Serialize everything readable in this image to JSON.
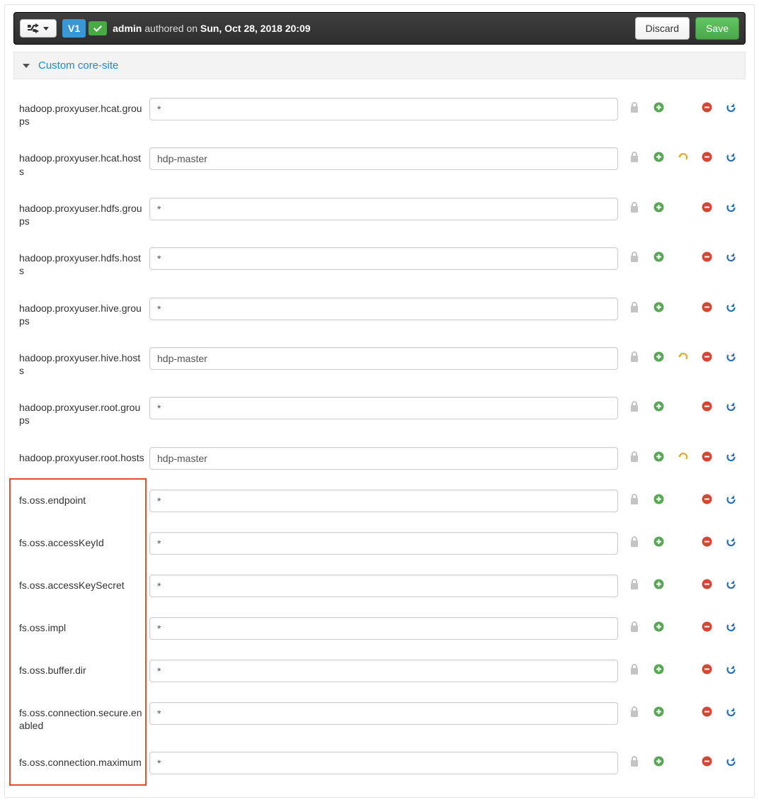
{
  "topbar": {
    "version_badge": "V1",
    "author_prefix": "admin",
    "authored_word": " authored on ",
    "authored_date": "Sun, Oct 28, 2018 20:09",
    "discard_label": "Discard",
    "save_label": "Save"
  },
  "section": {
    "title": "Custom core-site"
  },
  "rows": [
    {
      "label": "hadoop.proxyuser.hcat.groups",
      "value": "*",
      "undo": false
    },
    {
      "label": "hadoop.proxyuser.hcat.hosts",
      "value": "hdp-master",
      "undo": true
    },
    {
      "label": "hadoop.proxyuser.hdfs.groups",
      "value": "*",
      "undo": false
    },
    {
      "label": "hadoop.proxyuser.hdfs.hosts",
      "value": "*",
      "undo": false
    },
    {
      "label": "hadoop.proxyuser.hive.groups",
      "value": "*",
      "undo": false
    },
    {
      "label": "hadoop.proxyuser.hive.hosts",
      "value": "hdp-master",
      "undo": true
    },
    {
      "label": "hadoop.proxyuser.root.groups",
      "value": "*",
      "undo": false
    },
    {
      "label": "hadoop.proxyuser.root.hosts",
      "value": "hdp-master",
      "undo": true
    },
    {
      "label": "fs.oss.endpoint",
      "value": "*",
      "undo": false
    },
    {
      "label": "fs.oss.accessKeyId",
      "value": "*",
      "undo": false
    },
    {
      "label": "fs.oss.accessKeySecret",
      "value": "*",
      "undo": false
    },
    {
      "label": "fs.oss.impl",
      "value": "*",
      "undo": false
    },
    {
      "label": "fs.oss.buffer.dir",
      "value": "*",
      "undo": false
    },
    {
      "label": "fs.oss.connection.secure.enabled",
      "value": "*",
      "undo": false
    },
    {
      "label": "fs.oss.connection.maximum",
      "value": "*",
      "undo": false
    }
  ],
  "highlight": {
    "first_row": 8,
    "last_row": 14
  }
}
